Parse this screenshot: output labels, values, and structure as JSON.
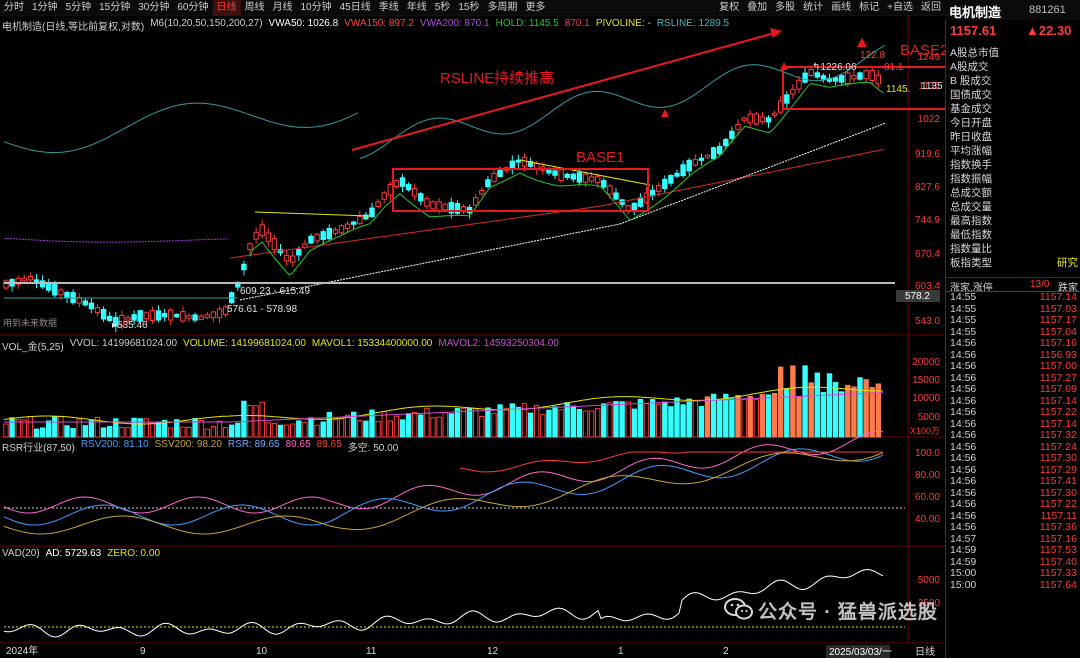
{
  "toolbar": {
    "periods": [
      "分时",
      "1分钟",
      "5分钟",
      "15分钟",
      "30分钟",
      "60分钟",
      "日线",
      "周线",
      "月线",
      "10分钟",
      "45日线",
      "季线",
      "年线",
      "5秒",
      "15秒",
      "多周期",
      "更多"
    ],
    "active": "日线",
    "right_tools": [
      "复权",
      "叠加",
      "多股",
      "统计",
      "画线",
      "标记",
      "+自选",
      "返回"
    ]
  },
  "stock": {
    "name": "电机制造",
    "code": "881261",
    "price": "1157.61",
    "change": "▲22.30"
  },
  "main_info": {
    "title": "电机制造(日线,等比前复权,对数)",
    "m6": "M6(10,20,50,150,200,27)",
    "vwa50": "VWA50: 1026.8",
    "vwa150": "VWA150: 897.2",
    "vwa200": "VWA200: 870.1",
    "hold": "HOLD: 1145.5",
    "hold2": "870.1",
    "pivoline": "PIVOLINE: -",
    "rsline": "RSLINE: 1289.5"
  },
  "main_axis": [
    "1249",
    "1135",
    "1022",
    "919.6",
    "827.6",
    "744.9",
    "670.4",
    "603.4",
    "543.0"
  ],
  "main_axis_extra": "578.2",
  "annotations": {
    "rsline": "RSLINE持续推高",
    "base1": "BASE1",
    "base2": "BASE2",
    "low_label": "535.46",
    "zone1": "609.23 - 615.49",
    "zone2": "576.61 - 578.98",
    "high_label": "1226.06",
    "high_r": "122.8",
    "high_r2": "81.1",
    "hold_label": "1145.",
    "future": "用到未来数据"
  },
  "volume_info": {
    "title": "VOL_金(5,25)",
    "vvol": "VVOL: 14199681024.00",
    "volume": "VOLUME: 14199681024.00",
    "mavol1": "MAVOL1: 15334400000.00",
    "mavol2": "MAVOL2: 14593250304.00"
  },
  "volume_axis": [
    "20000",
    "15000",
    "10000",
    "5000"
  ],
  "volume_unit": "X100万",
  "rsr_info": {
    "title": "RSR行业(87,50)",
    "rsv200": "RSV200: 81.10",
    "ssv200": "SSV200: 98.20",
    "rsr": "RSR: 89.65",
    "rsr2": "89.65",
    "rsr3": "89.65",
    "duokong": "多空: 50.00"
  },
  "rsr_axis": [
    "100.0",
    "80.00",
    "60.00",
    "40.00"
  ],
  "vad_info": {
    "title": "VAD(20)",
    "ad": "AD: 5729.63",
    "zero": "ZERO: 0.00"
  },
  "vad_axis": [
    "5000",
    "2500"
  ],
  "date_axis": [
    "2024年",
    "9",
    "10",
    "11",
    "12",
    "1",
    "2"
  ],
  "date_cursor": "2025/03/03/一",
  "date_mode": "日线",
  "quote_labels": [
    "A股总市值",
    "A股成交",
    "B 股成交",
    "国债成交",
    "基金成交",
    "今日开盘",
    "昨日收盘",
    "平均涨幅",
    "指数换手",
    "指数振幅",
    "总成交额",
    "总成交量",
    "最高指数",
    "最低指数",
    "指数量比",
    "板指类型"
  ],
  "quote_overlay": "1135",
  "board_type": "研究",
  "limit_row": {
    "label": "涨家.涨停",
    "value": "13/0",
    "right": "跌家"
  },
  "ticks": [
    {
      "t": "14:55",
      "p": "1157.14"
    },
    {
      "t": "14:55",
      "p": "1157.03"
    },
    {
      "t": "14:55",
      "p": "1157.17"
    },
    {
      "t": "14:55",
      "p": "1157.04"
    },
    {
      "t": "14:56",
      "p": "1157.16"
    },
    {
      "t": "14:56",
      "p": "1156.93"
    },
    {
      "t": "14:56",
      "p": "1157.00"
    },
    {
      "t": "14:56",
      "p": "1157.27"
    },
    {
      "t": "14:56",
      "p": "1157.09"
    },
    {
      "t": "14:56",
      "p": "1157.14"
    },
    {
      "t": "14:56",
      "p": "1157.22"
    },
    {
      "t": "14:56",
      "p": "1157.14"
    },
    {
      "t": "14:56",
      "p": "1157.32"
    },
    {
      "t": "14:56",
      "p": "1157.24"
    },
    {
      "t": "14:56",
      "p": "1157.30"
    },
    {
      "t": "14:56",
      "p": "1157.29"
    },
    {
      "t": "14:56",
      "p": "1157.41"
    },
    {
      "t": "14:56",
      "p": "1157.30"
    },
    {
      "t": "14:56",
      "p": "1157.22"
    },
    {
      "t": "14:56",
      "p": "1157.11"
    },
    {
      "t": "14:56",
      "p": "1157.36"
    },
    {
      "t": "14:57",
      "p": "1157.16"
    },
    {
      "t": "14:59",
      "p": "1157.53"
    },
    {
      "t": "14:59",
      "p": "1157.40"
    },
    {
      "t": "15:00",
      "p": "1157.33"
    },
    {
      "t": "15:00",
      "p": "1157.64"
    }
  ],
  "watermark": "公众号 · 猛兽派选股",
  "colors": {
    "up": "#ff3a3a",
    "down": "#33ffff",
    "vwa50": "#ffffff",
    "vwa150": "#d42a2a",
    "vwa200": "#9b3fd1",
    "hold": "#1fcf1f",
    "pivo": "#e5e500",
    "rsline": "#3fbfbf",
    "box": "#e8191e"
  }
}
